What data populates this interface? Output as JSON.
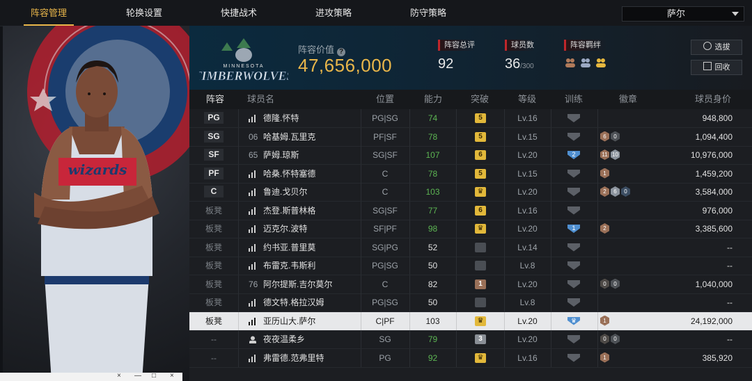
{
  "tabs": [
    {
      "label": "阵容管理",
      "active": true
    },
    {
      "label": "轮换设置",
      "active": false
    },
    {
      "label": "快捷战术",
      "active": false
    },
    {
      "label": "进攻策略",
      "active": false
    },
    {
      "label": "防守策略",
      "active": false
    }
  ],
  "player_select": {
    "value": "萨尔"
  },
  "header": {
    "team_logo": {
      "small": "MINNESOTA",
      "big": "TIMBERWOLVES"
    },
    "value_label": "阵容价值",
    "value": "47,656,000",
    "stats": [
      {
        "label": "阵容总评",
        "value": "92",
        "suffix": ""
      },
      {
        "label": "球员数",
        "value": "36",
        "suffix": "/300"
      },
      {
        "label": "阵容羁绊",
        "value": "",
        "suffix": ""
      }
    ],
    "buttons": [
      {
        "label": "选拔"
      },
      {
        "label": "回收"
      }
    ]
  },
  "table": {
    "headers": [
      "阵容",
      "球员名",
      "位置",
      "能力",
      "突破",
      "等级",
      "训练",
      "徽章",
      "球员身价"
    ],
    "rows": [
      {
        "slot": "PG",
        "boxed": true,
        "num": "",
        "name": "德隆.怀特",
        "pos": "PG|SG",
        "ovr": "74",
        "ovr_color": "#5db653",
        "pot": "5",
        "pot_type": "gold",
        "level": "Lv.16",
        "train": "",
        "badges": [],
        "value": "948,800"
      },
      {
        "slot": "SG",
        "boxed": true,
        "num": "06",
        "name": "哈基姆.瓦里克",
        "pos": "PF|SF",
        "ovr": "78",
        "ovr_color": "#5db653",
        "pot": "5",
        "pot_type": "gold",
        "level": "Lv.15",
        "train": "",
        "badges": [
          {
            "t": "6",
            "c": "#9a7058"
          },
          {
            "t": "0",
            "c": "#4e5257"
          }
        ],
        "value": "1,094,400"
      },
      {
        "slot": "SF",
        "boxed": true,
        "num": "65",
        "name": "萨姆.琼斯",
        "pos": "SG|SF",
        "ovr": "107",
        "ovr_color": "#5db653",
        "pot": "6",
        "pot_type": "gold",
        "level": "Lv.20",
        "train": "2",
        "train_color": "#4f8fd0",
        "badges": [
          {
            "t": "11",
            "c": "#9a7058"
          },
          {
            "t": "10",
            "c": "#8c949e"
          }
        ],
        "value": "10,976,000"
      },
      {
        "slot": "PF",
        "boxed": true,
        "num": "",
        "name": "哈桑.怀特塞德",
        "pos": "C",
        "ovr": "78",
        "ovr_color": "#5db653",
        "pot": "5",
        "pot_type": "gold",
        "level": "Lv.15",
        "train": "",
        "badges": [
          {
            "t": "1",
            "c": "#9a7058"
          }
        ],
        "value": "1,459,200"
      },
      {
        "slot": "C",
        "boxed": true,
        "num": "",
        "name": "鲁迪.戈贝尔",
        "pos": "C",
        "ovr": "103",
        "ovr_color": "#5db653",
        "pot": "♛",
        "pot_type": "gold",
        "level": "Lv.20",
        "train": "",
        "badges": [
          {
            "t": "2",
            "c": "#9a7058"
          },
          {
            "t": "6",
            "c": "#8c949e"
          },
          {
            "t": "0",
            "c": "#3c4e63"
          }
        ],
        "value": "3,584,000"
      },
      {
        "slot": "板凳",
        "boxed": false,
        "num": "",
        "name": "杰登.斯普林格",
        "pos": "SG|SF",
        "ovr": "77",
        "ovr_color": "#5db653",
        "pot": "6",
        "pot_type": "gold",
        "level": "Lv.16",
        "train": "",
        "badges": [],
        "value": "976,000"
      },
      {
        "slot": "板凳",
        "boxed": false,
        "num": "",
        "name": "迈克尔.波特",
        "pos": "SF|PF",
        "ovr": "98",
        "ovr_color": "#5db653",
        "pot": "♛",
        "pot_type": "gold",
        "level": "Lv.20",
        "train": "1",
        "train_color": "#4f8fd0",
        "badges": [
          {
            "t": "2",
            "c": "#9a7058"
          }
        ],
        "value": "3,385,600"
      },
      {
        "slot": "板凳",
        "boxed": false,
        "num": "",
        "name": "约书亚.普里莫",
        "pos": "SG|PG",
        "ovr": "52",
        "ovr_color": "#e0e0e0",
        "pot": "",
        "pot_type": "none",
        "level": "Lv.14",
        "train": "",
        "badges": [],
        "value": "--"
      },
      {
        "slot": "板凳",
        "boxed": false,
        "num": "",
        "name": "布雷克.韦斯利",
        "pos": "PG|SG",
        "ovr": "50",
        "ovr_color": "#e0e0e0",
        "pot": "",
        "pot_type": "none",
        "level": "Lv.8",
        "train": "",
        "badges": [],
        "value": "--"
      },
      {
        "slot": "板凳",
        "boxed": false,
        "num": "76",
        "name": "阿尔提斯.吉尔莫尔",
        "pos": "C",
        "ovr": "82",
        "ovr_color": "#e0e0e0",
        "pot": "1",
        "pot_type": "bronze",
        "level": "Lv.20",
        "train": "",
        "badges": [
          {
            "t": "0",
            "c": "#4e4a47"
          },
          {
            "t": "0",
            "c": "#4e5257"
          }
        ],
        "value": "1,040,000"
      },
      {
        "slot": "板凳",
        "boxed": false,
        "num": "",
        "name": "德文特.格拉汉姆",
        "pos": "PG|SG",
        "ovr": "50",
        "ovr_color": "#e0e0e0",
        "pot": "",
        "pot_type": "none",
        "level": "Lv.8",
        "train": "",
        "badges": [],
        "value": "--"
      },
      {
        "slot": "板凳",
        "boxed": false,
        "num": "",
        "name": "亚历山大.萨尔",
        "pos": "C|PF",
        "ovr": "103",
        "ovr_color": "#1a1a1a",
        "pot": "♛",
        "pot_type": "gold",
        "level": "Lv.20",
        "train": "♛",
        "train_color": "#4f8fd0",
        "badges": [
          {
            "t": "1",
            "c": "#9a7058"
          }
        ],
        "value": "24,192,000",
        "highlight": true
      },
      {
        "slot": "--",
        "boxed": false,
        "num": "",
        "name": "夜夜温柔乡",
        "pos": "SG",
        "ovr": "79",
        "ovr_color": "#5db653",
        "pot": "3",
        "pot_type": "silver",
        "level": "Lv.20",
        "train": "",
        "badges": [
          {
            "t": "0",
            "c": "#4e4a47"
          },
          {
            "t": "0",
            "c": "#4e5257"
          }
        ],
        "value": "--",
        "person_icon": true
      },
      {
        "slot": "--",
        "boxed": false,
        "num": "",
        "name": "弗雷德.范弗里特",
        "pos": "PG",
        "ovr": "92",
        "ovr_color": "#5db653",
        "pot": "♛",
        "pot_type": "gold",
        "level": "Lv.16",
        "train": "",
        "badges": [
          {
            "t": "1",
            "c": "#9a7058"
          }
        ],
        "value": "385,920"
      }
    ]
  },
  "window_controls": [
    "×",
    "—",
    "□",
    "×"
  ]
}
